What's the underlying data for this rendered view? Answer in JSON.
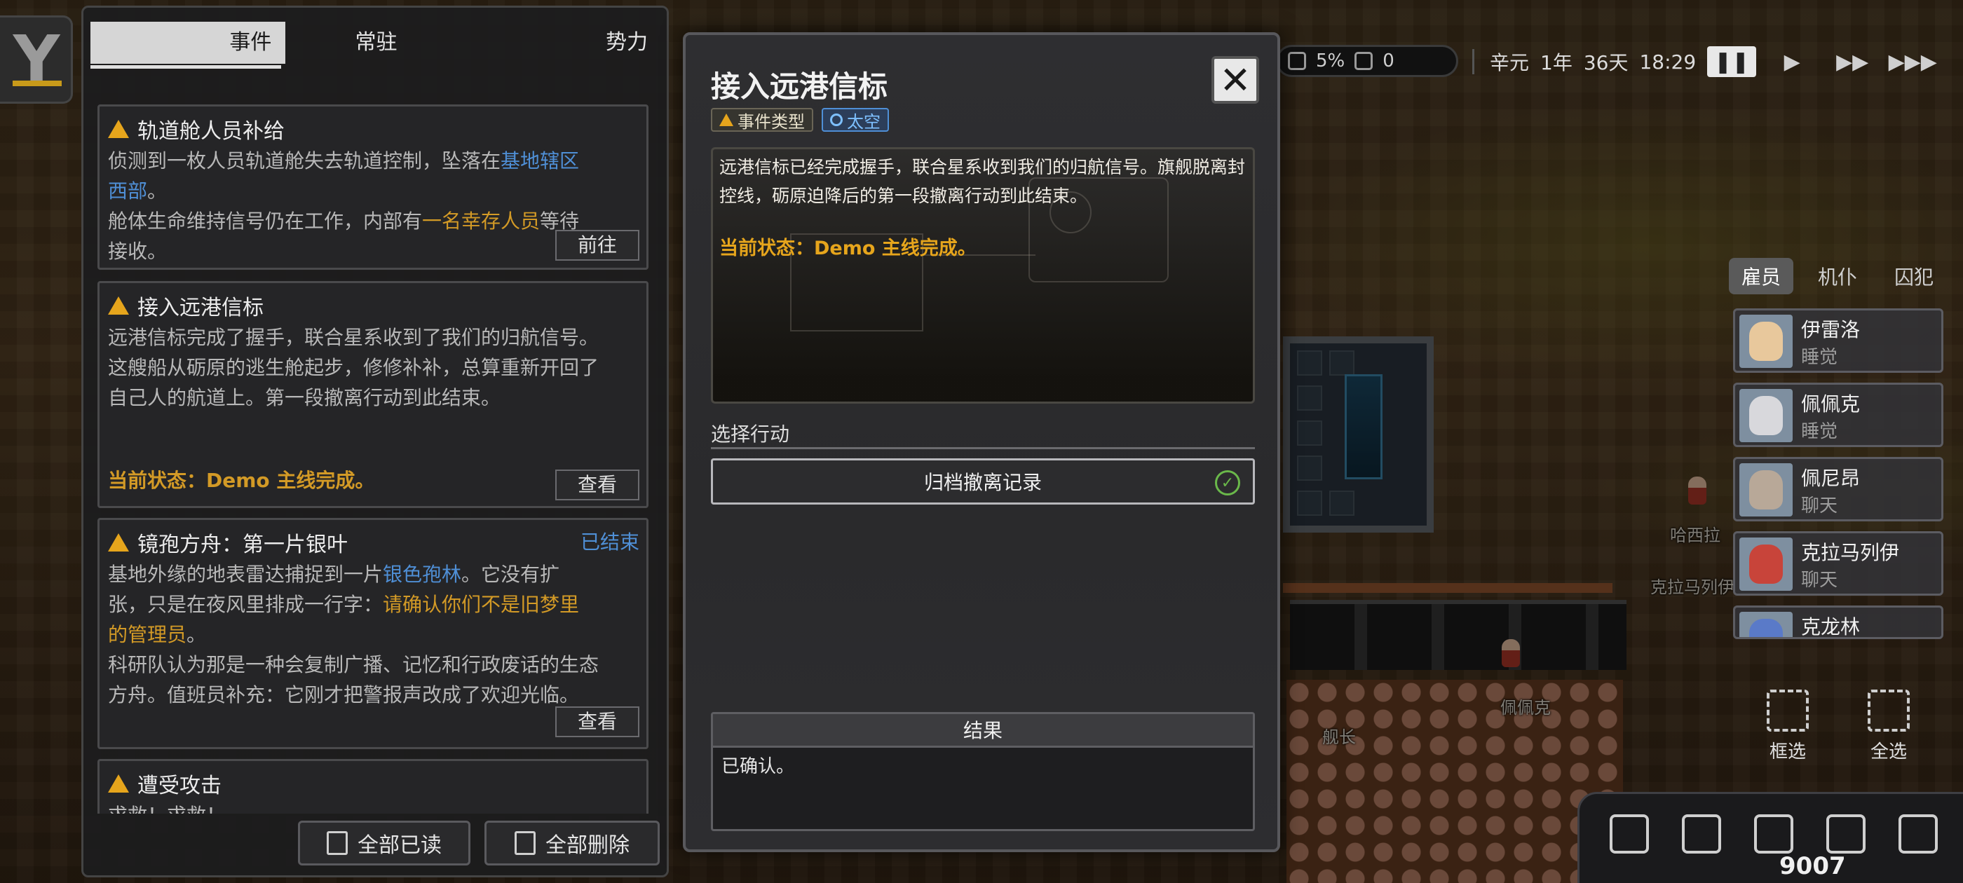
{
  "topbar": {
    "percent": "5%",
    "count": "0",
    "era": "辛元",
    "year": "1年",
    "day": "36天",
    "time": "18:29"
  },
  "event_panel": {
    "tabs": [
      {
        "label": "事件",
        "active": true
      },
      {
        "label": "常驻",
        "active": false
      },
      {
        "label": "势力",
        "active": false
      }
    ],
    "events": [
      {
        "title": "轨道舱人员补给",
        "body_1": "侦测到一枚人员轨道舱失去轨道控制，坠落在",
        "link_1": "基地辖区西部",
        "body_2": "。",
        "body_3": "舱体生命维持信号仍在工作，内部有",
        "link_2": "一名幸存人员",
        "body_4": "等待接收。",
        "button": "前往"
      },
      {
        "title": "接入远港信标",
        "body": "远港信标完成了握手，联合星系收到了我们的归航信号。这艘船从砺原的逃生舱起步，修修补补，总算重新开回了自己人的航道上。第一段撤离行动到此结束。",
        "status": "当前状态：Demo 主线完成。",
        "button": "查看"
      },
      {
        "title": "镜孢方舟：第一片银叶",
        "state": "已结束",
        "body_1": "基地外缘的地表雷达捕捉到一片",
        "link_1": "银色孢林",
        "body_2": "。它没有扩张，只是在夜风里排成一行字：",
        "link_2": "请确认你们不是旧梦里的管理员",
        "body_3": "。",
        "body_4": "科研队认为那是一种会复制广播、记忆和行政废话的生态方舟。值班员补充：它刚才把警报声改成了欢迎光临。",
        "button": "查看"
      },
      {
        "title": "遭受攻击",
        "body": "求救！求救！"
      }
    ],
    "mark_all_read": "全部已读",
    "delete_all": "全部删除"
  },
  "modal": {
    "title": "接入远港信标",
    "tag_type": "事件类型",
    "tag_space": "太空",
    "description": "远港信标已经完成握手，联合星系收到我们的归航信号。旗舰脱离封控线，砺原迫降后的第一段撤离行动到此结束。",
    "status": "当前状态：Demo 主线完成。",
    "choose_label": "选择行动",
    "action": "归档撤离记录",
    "result_title": "结果",
    "result_text": "已确认。"
  },
  "colonists": {
    "tabs": [
      {
        "label": "雇员",
        "active": true
      },
      {
        "label": "机仆",
        "active": false
      },
      {
        "label": "囚犯",
        "active": false
      }
    ],
    "list": [
      {
        "name": "伊雷洛",
        "status": "睡觉"
      },
      {
        "name": "佩佩克",
        "status": "睡觉"
      },
      {
        "name": "佩尼昂",
        "status": "聊天"
      },
      {
        "name": "克拉马列伊",
        "status": "聊天"
      },
      {
        "name": "克龙林",
        "status": ""
      }
    ]
  },
  "tools": {
    "box_select": "框选",
    "select_all": "全选"
  },
  "bottom_bar": {
    "resource_count": "9007"
  },
  "world_labels": {
    "l1": "哈西拉",
    "l2": "克拉马列伊",
    "l3": "佩佩克",
    "l4": "舰长"
  }
}
